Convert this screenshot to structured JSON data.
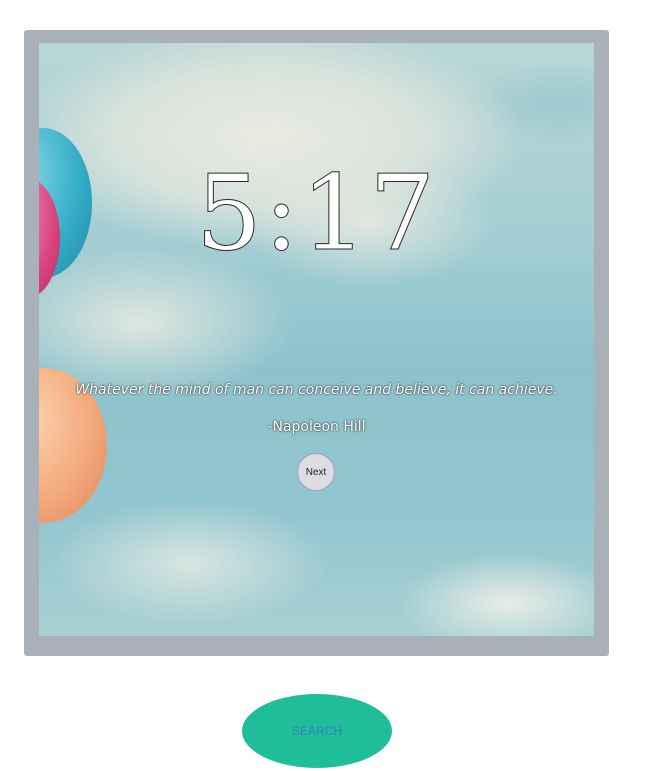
{
  "clock": {
    "time": "5:17"
  },
  "quote": {
    "text": "Whatever the mind of man can conceive and believe, it can achieve.",
    "author": "-Napoleon Hill"
  },
  "buttons": {
    "next_label": "Next",
    "search_label": "SEARCH"
  },
  "colors": {
    "frame": "#a9b0b8",
    "search_button": "#1fbd9a",
    "search_text": "#3a7bbf",
    "next_button": "#dcdde3"
  }
}
